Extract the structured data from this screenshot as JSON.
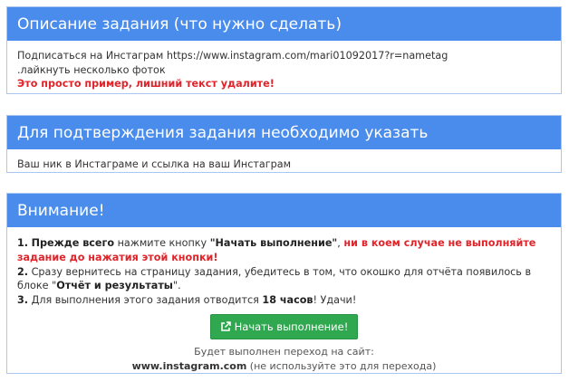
{
  "description_panel": {
    "title": "Описание задания (что нужно сделать)",
    "line1": "Подписаться на Инстаграм https://www.instagram.com/mari01092017?r=nametag",
    "line2": ".лайкнуть несколько фоток",
    "warning": "Это просто пример, лишний текст удалите!"
  },
  "confirmation_panel": {
    "title": "Для подтверждения задания необходимо указать",
    "text": "Ваш ник в Инстаграме и ссылка на ваш Инстаграм"
  },
  "attention_panel": {
    "title": "Внимание!",
    "step1_number": "1.",
    "step1_bold": "Прежде всего",
    "step1_text": " нажмите кнопку ",
    "step1_button_ref": "\"Начать выполнение\"",
    "step1_comma": ", ",
    "step1_warning": "ни в коем случае не выполняйте задание до нажатия этой кнопки!",
    "step2_number": "2.",
    "step2_text": " Сразу вернитесь на страницу задания, убедитесь в том, что окошко для отчёта появилось в блоке \"",
    "step2_block": "Отчёт и результаты",
    "step2_end": "\".",
    "step3_number": "3.",
    "step3_text": " Для выполнения этого задания отводится ",
    "step3_hours": "18 часов",
    "step3_end": "! Удачи!",
    "start_button_label": "Начать выполнение!",
    "start_button_icon": "external-link-icon",
    "redirect_note": "Будет выполнен переход на сайт:",
    "redirect_site": "www.instagram.com",
    "redirect_hint": " (не используйте это для перехода)"
  },
  "colors": {
    "header_blue": "#4a8cec",
    "panel_border": "#a9c7f2",
    "warning_red": "#e0242a",
    "button_green": "#2fa84f"
  }
}
